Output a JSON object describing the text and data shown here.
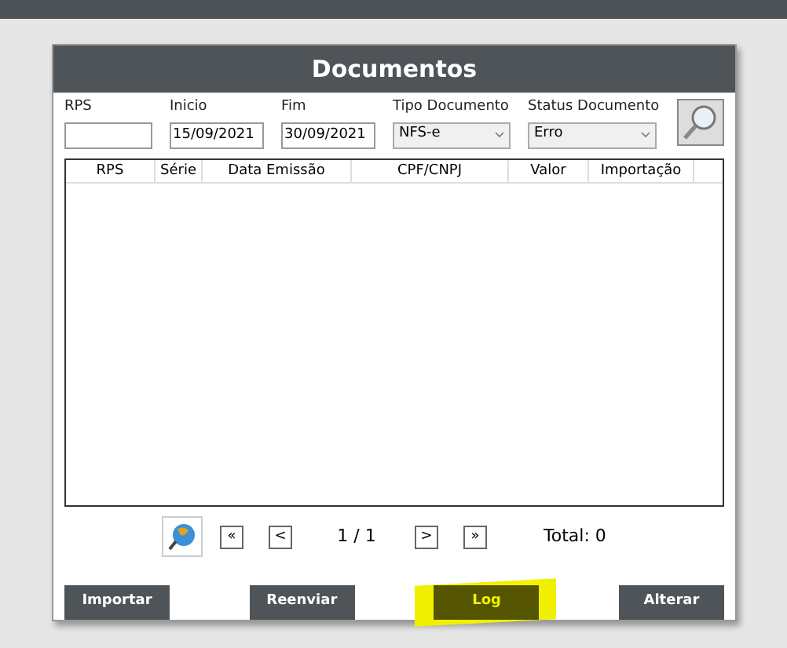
{
  "dialog": {
    "title": "Documentos"
  },
  "filters": [
    {
      "kind": "text",
      "label": "RPS"
    },
    {
      "kind": "text",
      "label": "Inicio",
      "value": "15/09/2021"
    },
    {
      "kind": "text",
      "label": "Fim",
      "value": "30/09/2021"
    },
    {
      "kind": "select",
      "label": "Tipo Documento",
      "value": "NFS-e"
    },
    {
      "kind": "select",
      "label": "Status Documento",
      "value": "Erro"
    }
  ],
  "table": {
    "columns": [
      "RPS",
      "Série",
      "Data Emissão",
      "CPF/CNPJ",
      "Valor",
      "Importação"
    ]
  },
  "pager": {
    "first": "«",
    "prev": "<",
    "page": "1 / 1",
    "next": ">",
    "last": "»",
    "total": "Total: 0"
  },
  "buttons": [
    {
      "label": "Importar",
      "highlighted": false
    },
    {
      "label": "Reenviar",
      "highlighted": false
    },
    {
      "label": "Log",
      "highlighted": true
    },
    {
      "label": "Alterar",
      "highlighted": false
    }
  ]
}
